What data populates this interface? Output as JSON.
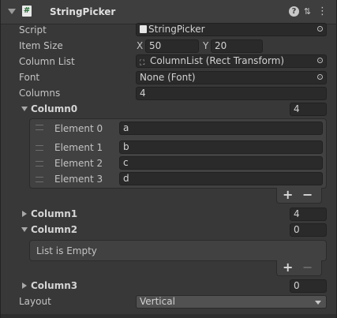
{
  "component": {
    "title": "StringPicker",
    "script_glyph": "#"
  },
  "fields": {
    "script": {
      "label": "Script",
      "value": "StringPicker"
    },
    "item_size": {
      "label": "Item Size",
      "x_label": "X",
      "x_value": "50",
      "y_label": "Y",
      "y_value": "20"
    },
    "column_list": {
      "label": "Column List",
      "value": "ColumnList (Rect Transform)"
    },
    "font": {
      "label": "Font",
      "value": "None (Font)"
    },
    "columns": {
      "label": "Columns",
      "value": "4"
    },
    "layout": {
      "label": "Layout",
      "value": "Vertical"
    }
  },
  "column0": {
    "label": "Column0",
    "size": "4",
    "elements": [
      {
        "label": "Element 0",
        "value": "a"
      },
      {
        "label": "Element 1",
        "value": "b"
      },
      {
        "label": "Element 2",
        "value": "c"
      },
      {
        "label": "Element 3",
        "value": "d"
      }
    ]
  },
  "column1": {
    "label": "Column1",
    "size": "4"
  },
  "column2": {
    "label": "Column2",
    "size": "0",
    "empty_text": "List is Empty"
  },
  "column3": {
    "label": "Column3",
    "size": "0"
  },
  "list_buttons": {
    "plus": "+",
    "minus": "−"
  },
  "icons": {
    "help": "?",
    "presets": "⇅",
    "menu": "⋮",
    "rect_transform": "⛶"
  }
}
